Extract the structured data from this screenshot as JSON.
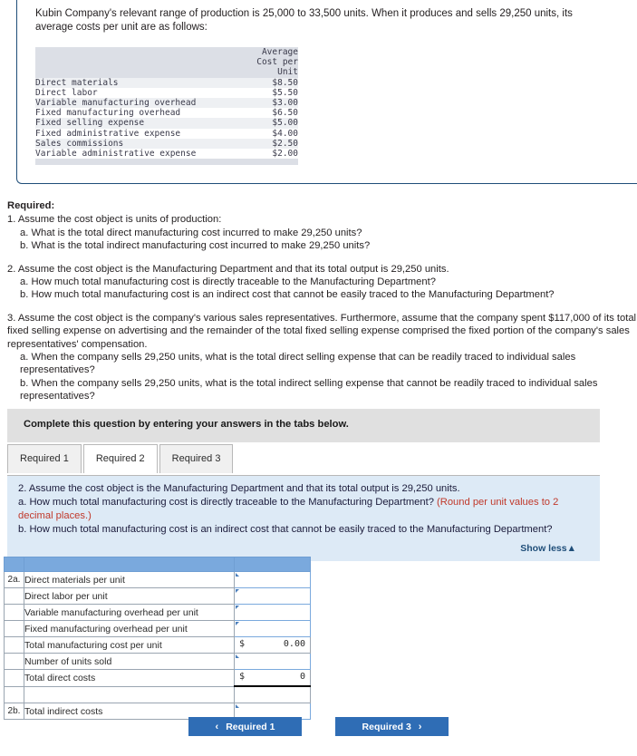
{
  "question": {
    "stem": "Kubin Company's relevant range of production is 25,000 to 33,500 units. When it produces and sells 29,250 units, its average costs per unit are as follows:",
    "cost_table": {
      "header_blank": "",
      "header_value": "Average\nCost per\nUnit",
      "rows": [
        {
          "label": "Direct materials",
          "value": "$8.50"
        },
        {
          "label": "Direct labor",
          "value": "$5.50"
        },
        {
          "label": "Variable manufacturing overhead",
          "value": "$3.00"
        },
        {
          "label": "Fixed manufacturing overhead",
          "value": "$6.50"
        },
        {
          "label": "Fixed selling expense",
          "value": "$5.00"
        },
        {
          "label": "Fixed administrative expense",
          "value": "$4.00"
        },
        {
          "label": "Sales commissions",
          "value": "$2.50"
        },
        {
          "label": "Variable administrative expense",
          "value": "$2.00"
        }
      ]
    }
  },
  "required": {
    "title": "Required:",
    "item1_intro": "1. Assume the cost object is units of production:",
    "item1_a": "a. What is the total direct manufacturing cost incurred to make 29,250 units?",
    "item1_b": "b. What is the total indirect manufacturing cost incurred to make 29,250 units?",
    "item2_intro": "2. Assume the cost object is the Manufacturing Department and that its total output is 29,250 units.",
    "item2_a": "a. How much total manufacturing cost is directly traceable to the Manufacturing Department?",
    "item2_b": "b. How much total manufacturing cost is an indirect cost that cannot be easily traced to the Manufacturing Department?",
    "item3_intro": "3. Assume the cost object is the company's various sales representatives. Furthermore, assume that the company spent  $117,000 of its total fixed selling expense on advertising and the remainder of the total fixed selling expense comprised the fixed portion of the company's sales representatives' compensation.",
    "item3_a": "a. When the company sells 29,250 units, what is the total direct selling expense that can be readily traced to individual sales representatives?",
    "item3_b": "b. When the company sells 29,250 units, what is the total indirect selling expense that cannot be readily traced to individual sales representatives?"
  },
  "banner": {
    "text": "Complete this question by entering your answers in the tabs below."
  },
  "tabs": [
    {
      "label": "Required 1",
      "active": false
    },
    {
      "label": "Required 2",
      "active": true
    },
    {
      "label": "Required 3",
      "active": false
    }
  ],
  "panel": {
    "line1": "2. Assume the cost object is the Manufacturing Department and that its total output is 29,250 units.",
    "line2a": "a. How much total manufacturing cost is directly traceable to the Manufacturing Department? ",
    "line2b_red": "(Round per unit values to 2 decimal places.)",
    "line3": "b. How much total manufacturing cost is an indirect cost that cannot be easily traced to the Manufacturing Department?",
    "show_less": "Show less",
    "show_less_arrow": "▲"
  },
  "answer_grid": {
    "rows": [
      {
        "num": "2a.",
        "label": "Direct materials per unit",
        "kind": "input"
      },
      {
        "num": "",
        "label": "Direct labor per unit",
        "kind": "input"
      },
      {
        "num": "",
        "label": "Variable manufacturing overhead per unit",
        "kind": "input"
      },
      {
        "num": "",
        "label": "Fixed manufacturing overhead per unit",
        "kind": "input"
      },
      {
        "num": "",
        "label": "Total manufacturing cost per unit",
        "kind": "readonly",
        "currency": "$",
        "value": "0.00"
      },
      {
        "num": "",
        "label": "Number of units sold",
        "kind": "input"
      },
      {
        "num": "",
        "label": "Total direct costs",
        "kind": "readonly",
        "currency": "$",
        "value": "0",
        "thick": true
      },
      {
        "num": "",
        "label": "",
        "kind": "blank"
      },
      {
        "num": "2b.",
        "label": "Total indirect costs",
        "kind": "input"
      }
    ]
  },
  "nav": {
    "prev_label": "Required 1",
    "prev_chevron": "‹",
    "next_label": "Required 3",
    "next_chevron": "›"
  },
  "colors": {
    "card_border": "#1f4e79",
    "banner_bg": "#e0e0e0",
    "panel_bg": "#ddeaf6",
    "accent_blue": "#2f6db5",
    "grid_header": "#7aa9dd",
    "red_note": "#c0392b"
  }
}
